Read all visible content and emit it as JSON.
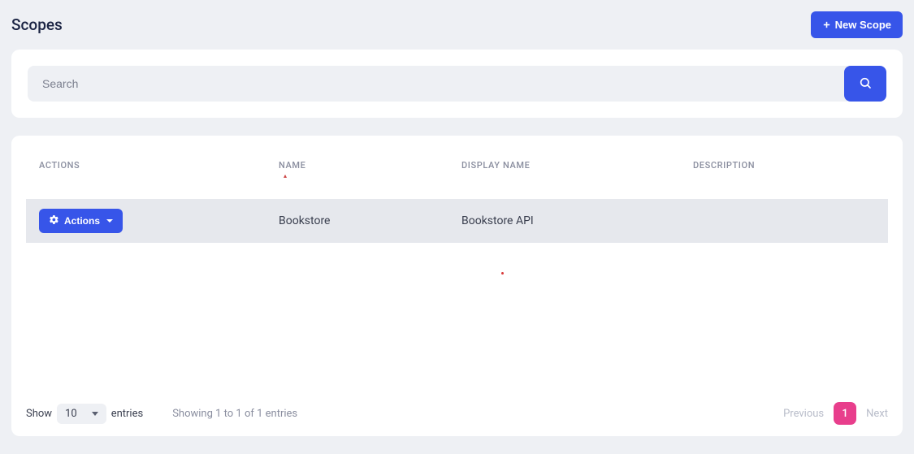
{
  "header": {
    "title": "Scopes",
    "new_scope_label": "New Scope"
  },
  "search": {
    "placeholder": "Search"
  },
  "table": {
    "columns": {
      "actions": "ACTIONS",
      "name": "NAME",
      "display_name": "DISPLAY NAME",
      "description": "DESCRIPTION"
    },
    "actions_btn_label": "Actions",
    "rows": [
      {
        "name": "Bookstore",
        "display_name": "Bookstore API",
        "description": ""
      }
    ]
  },
  "footer": {
    "show_label": "Show",
    "entries_label": "entries",
    "page_size": "10",
    "info": "Showing 1 to 1 of 1 entries",
    "prev": "Previous",
    "next": "Next",
    "current_page": "1"
  }
}
